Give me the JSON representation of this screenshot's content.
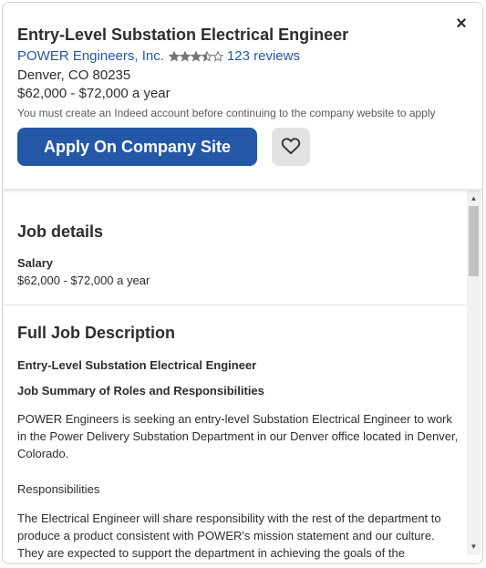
{
  "header": {
    "job_title": "Entry-Level Substation Electrical Engineer",
    "company_name": "POWER Engineers, Inc.",
    "rating": 3.5,
    "rating_max": 5,
    "reviews_label": "123 reviews",
    "location": "Denver, CO 80235",
    "salary": "$62,000 - $72,000 a year",
    "notice": "You must create an Indeed account before continuing to the company website to apply",
    "apply_label": "Apply On Company Site",
    "close_glyph": "×"
  },
  "details": {
    "heading": "Job details",
    "salary_label": "Salary",
    "salary_value": "$62,000 - $72,000 a year"
  },
  "description": {
    "heading": "Full Job Description",
    "subtitle": "Entry-Level Substation Electrical Engineer",
    "summary_heading": "Job Summary of Roles and Responsibilities",
    "paragraph1": "POWER Engineers is seeking an entry-level Substation Electrical Engineer to work in the Power Delivery Substation Department in our Denver office located in Denver, Colorado.",
    "responsibilities_label": "Responsibilities",
    "paragraph2": "The Electrical Engineer will share responsibility with the rest of the department to produce a product consistent with POWER's mission statement and our culture. They are expected to support the department in achieving the goals of the"
  },
  "scrollbar": {
    "up_glyph": "▲",
    "down_glyph": "▼"
  },
  "colors": {
    "link": "#2557a7",
    "apply_button": "#2557a7",
    "star": "#767676"
  },
  "icons": {
    "close": "close-icon",
    "save": "heart-icon",
    "star": "star-icon"
  }
}
